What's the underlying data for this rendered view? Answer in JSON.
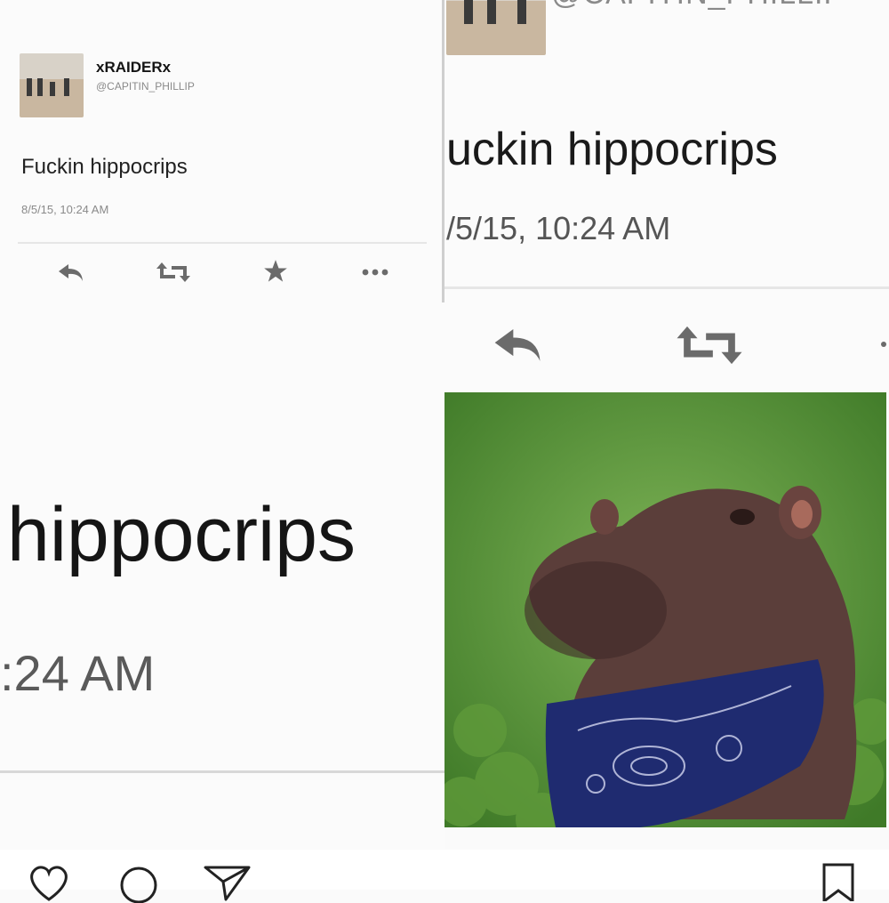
{
  "colors": {
    "grass": "#4f8a2f",
    "hippo": "#5a3a36",
    "bandana": "#1e2a6e",
    "icon_gray": "#6b6b6b"
  },
  "tweet_small": {
    "display_name": "xRAIDERx",
    "handle": "@CAPITIN_PHILLIP",
    "text": "Fuckin hippocrips",
    "timestamp": "8/5/15, 10:24 AM",
    "actions": [
      "reply-icon",
      "retweet-icon",
      "favorite-icon",
      "more-icon"
    ]
  },
  "tweet_zoom": {
    "handle_partial": "@CAPITIN_PHILLIP",
    "text_partial": "uckin hippocrips",
    "timestamp_partial": "/5/15, 10:24 AM",
    "actions": [
      "reply-icon",
      "retweet-icon"
    ]
  },
  "tweet_big": {
    "text_partial": "hippocrips",
    "timestamp_partial": ":24 AM"
  },
  "photo": {
    "subject": "hippo-wearing-bandana-image"
  },
  "instagram_actions": [
    "heart-icon",
    "comment-icon",
    "share-icon",
    "bookmark-icon"
  ]
}
